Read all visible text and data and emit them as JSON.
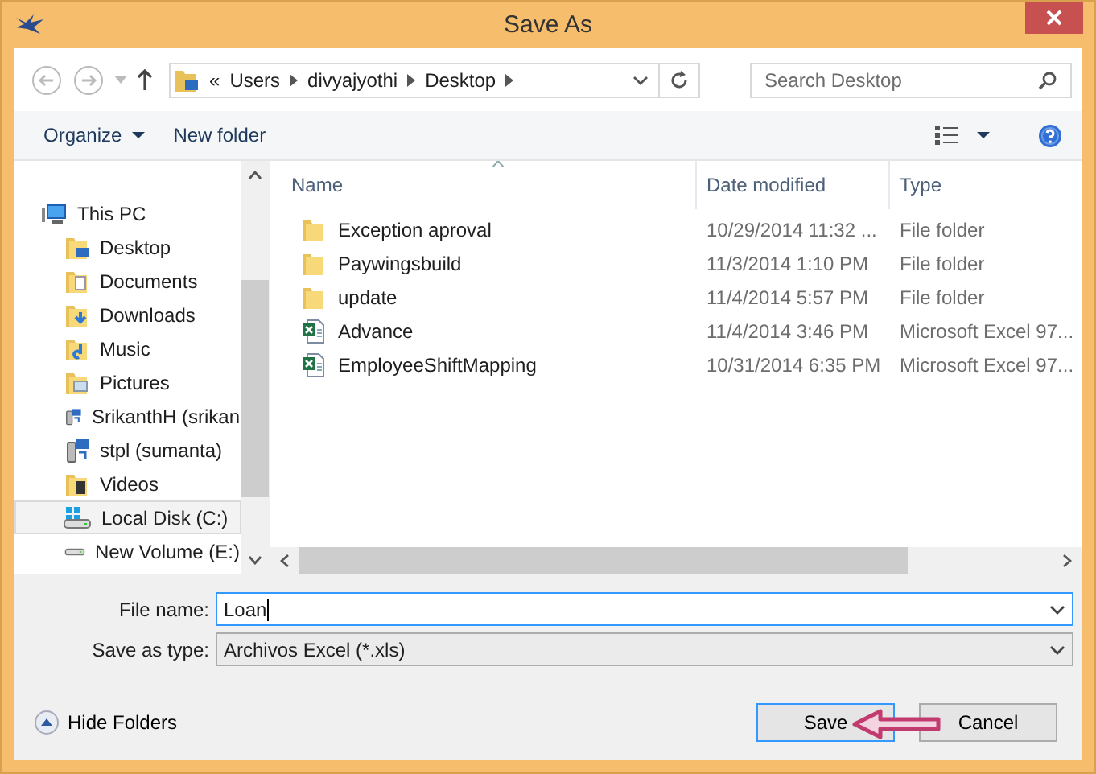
{
  "window": {
    "title": "Save As"
  },
  "navigation": {
    "breadcrumb_prefix": "«",
    "breadcrumb": [
      "Users",
      "divyajyothi",
      "Desktop"
    ],
    "search": {
      "placeholder": "Search Desktop"
    }
  },
  "toolbar": {
    "organize": "Organize",
    "new_folder": "New folder"
  },
  "sidebar": {
    "items": [
      {
        "label": "This PC",
        "kind": "pc",
        "selected": false,
        "children": [
          {
            "label": "Desktop",
            "kind": "desktop",
            "selected": false
          },
          {
            "label": "Documents",
            "kind": "documents",
            "selected": false
          },
          {
            "label": "Downloads",
            "kind": "downloads",
            "selected": false
          },
          {
            "label": "Music",
            "kind": "music",
            "selected": false
          },
          {
            "label": "Pictures",
            "kind": "pictures",
            "selected": false
          },
          {
            "label": "SrikanthH (srikan",
            "kind": "network",
            "selected": false
          },
          {
            "label": "stpl (sumanta)",
            "kind": "network",
            "selected": false
          },
          {
            "label": "Videos",
            "kind": "videos",
            "selected": false
          },
          {
            "label": "Local Disk (C:)",
            "kind": "system",
            "selected": true
          },
          {
            "label": "New Volume (E:)",
            "kind": "drive",
            "selected": false
          }
        ]
      }
    ]
  },
  "table": {
    "columns": [
      "Name",
      "Date modified",
      "Type"
    ],
    "rows": [
      {
        "kind": "folder",
        "name": "Exception aproval",
        "date": "10/29/2014 11:32 ...",
        "type": "File folder"
      },
      {
        "kind": "folder",
        "name": "Paywingsbuild",
        "date": "11/3/2014 1:10 PM",
        "type": "File folder"
      },
      {
        "kind": "folder",
        "name": "update",
        "date": "11/4/2014 5:57 PM",
        "type": "File folder"
      },
      {
        "kind": "excel",
        "name": "Advance",
        "date": "11/4/2014 3:46 PM",
        "type": "Microsoft Excel 97..."
      },
      {
        "kind": "excel",
        "name": "EmployeeShiftMapping",
        "date": "10/31/2014 6:35 PM",
        "type": "Microsoft Excel 97..."
      }
    ]
  },
  "form": {
    "file_name": {
      "label": "File name:",
      "value": "Loan"
    },
    "save_as_type": {
      "label": "Save as type:",
      "value": "Archivos Excel (*.xls)"
    }
  },
  "footer": {
    "hide_folders": "Hide Folders",
    "buttons": [
      {
        "label": "Save",
        "default": true
      },
      {
        "label": "Cancel",
        "default": false
      }
    ]
  }
}
